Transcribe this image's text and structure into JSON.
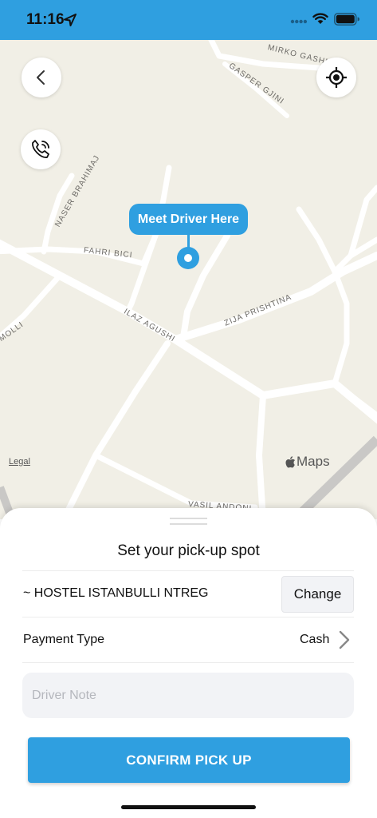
{
  "status_bar": {
    "time": "11:16",
    "icons": [
      "location-arrow-icon",
      "signal-dots-icon",
      "wifi-icon",
      "battery-icon"
    ]
  },
  "map": {
    "streets": [
      "MIRKO GASHI",
      "GASPER GJINI",
      "NASER BRAHIMAJ",
      "FAHRI BICI",
      "ILAZ AGUSHI",
      "ZIJA PRISHTINA",
      "MOLLI",
      "VASIL ANDONI"
    ],
    "marker_label": "Meet Driver Here",
    "legal": "Legal",
    "maps_brand": "Maps",
    "buttons": [
      "back-icon",
      "crosshair-icon",
      "phone-call-icon"
    ],
    "colors": {
      "accent": "#2f9fe0",
      "background": "#f1efe6",
      "road": "#ffffff"
    }
  },
  "sheet": {
    "title": "Set your pick-up spot",
    "address": "~ HOSTEL ISTANBULLI NTREG",
    "change_label": "Change",
    "payment_label": "Payment Type",
    "payment_value": "Cash",
    "note_placeholder": "Driver Note",
    "confirm_label": "CONFIRM PICK UP"
  }
}
